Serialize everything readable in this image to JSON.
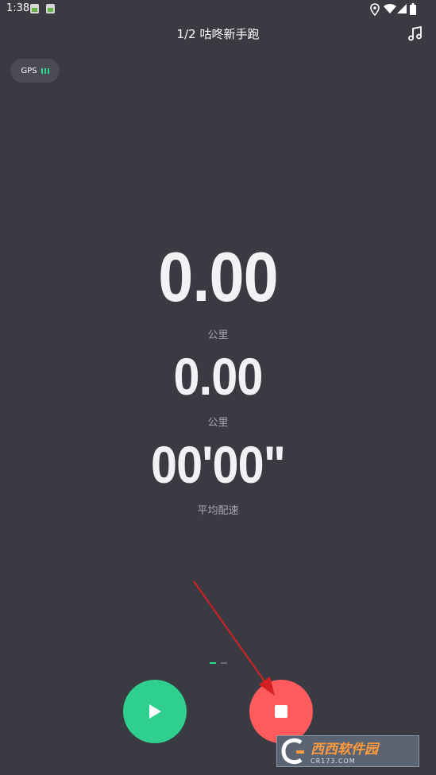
{
  "status_bar": {
    "time": "1:38",
    "icons": [
      "image-notification-icon",
      "image-notification-icon",
      "location-icon",
      "wifi-icon",
      "signal-icon",
      "battery-icon"
    ]
  },
  "header": {
    "title": "1/2 咕咚新手跑",
    "music_icon": "music-note-icon"
  },
  "gps": {
    "label": "GPS",
    "signal_bars": 3,
    "color": "#2fd98c"
  },
  "metrics": [
    {
      "value": "0.00",
      "unit": "公里"
    },
    {
      "value": "0.00",
      "unit": "公里"
    },
    {
      "value": "00'00\"",
      "unit": "平均配速"
    }
  ],
  "pager": {
    "pages": 2,
    "active_index": 0
  },
  "controls": {
    "play_icon": "play-icon",
    "stop_icon": "stop-icon",
    "play_color": "#2fd08d",
    "stop_color": "#ff5a5c"
  },
  "annotation": {
    "arrow_color": "#d42020"
  },
  "watermark": {
    "main": "西西软件园",
    "sub": "CR173.COM"
  },
  "colors": {
    "background": "#3a3a43",
    "accent_green": "#2fd98c"
  }
}
